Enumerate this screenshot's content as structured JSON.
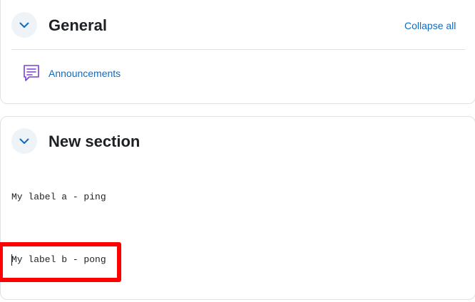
{
  "sections": [
    {
      "title": "General",
      "collapse_all_label": "Collapse all",
      "activities": [
        {
          "icon": "forum-chat-icon",
          "label": "Announcements"
        }
      ]
    },
    {
      "title": "New section",
      "labels": [
        {
          "text": "My label a - ping"
        },
        {
          "text": "My label b - pong"
        }
      ]
    }
  ],
  "colors": {
    "link": "#0f6cbf",
    "toggle_bg": "#eef3f8",
    "icon_purple": "#7b3ed6",
    "highlight": "#ff0000"
  }
}
